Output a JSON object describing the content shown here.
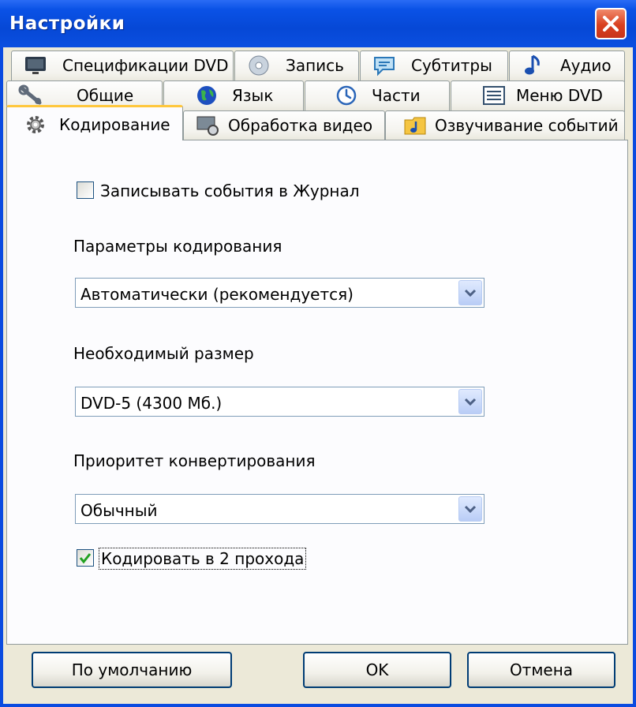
{
  "window": {
    "title": "Настройки"
  },
  "tabs": {
    "row1": [
      {
        "label": "Спецификации DVD",
        "icon": "monitor-icon"
      },
      {
        "label": "Запись",
        "icon": "disc-icon"
      },
      {
        "label": "Субтитры",
        "icon": "speech-bubble-icon"
      },
      {
        "label": "Аудио",
        "icon": "music-note-icon"
      }
    ],
    "row2": [
      {
        "label": "Общие",
        "icon": "tools-icon"
      },
      {
        "label": "Язык",
        "icon": "globe-icon"
      },
      {
        "label": "Части",
        "icon": "clock-icon"
      },
      {
        "label": "Меню DVD",
        "icon": "menu-list-icon"
      }
    ],
    "row3": [
      {
        "label": "Кодирование",
        "icon": "gear-icon",
        "active": true
      },
      {
        "label": "Обработка видео",
        "icon": "video-gear-icon"
      },
      {
        "label": "Озвучивание событий",
        "icon": "folder-music-icon"
      }
    ]
  },
  "panel": {
    "log_events": {
      "label": "Записывать события в Журнал",
      "checked": false
    },
    "encoding_params": {
      "label": "Параметры кодирования",
      "value": "Автоматически (рекомендуется)"
    },
    "required_size": {
      "label": "Необходимый размер",
      "value": "DVD-5 (4300 Мб.)"
    },
    "priority": {
      "label": "Приоритет конвертирования",
      "value": "Обычный"
    },
    "two_pass": {
      "label": "Кодировать в 2 прохода",
      "checked": true
    }
  },
  "buttons": {
    "defaults": "По умолчанию",
    "ok": "OK",
    "cancel": "Отмена"
  }
}
